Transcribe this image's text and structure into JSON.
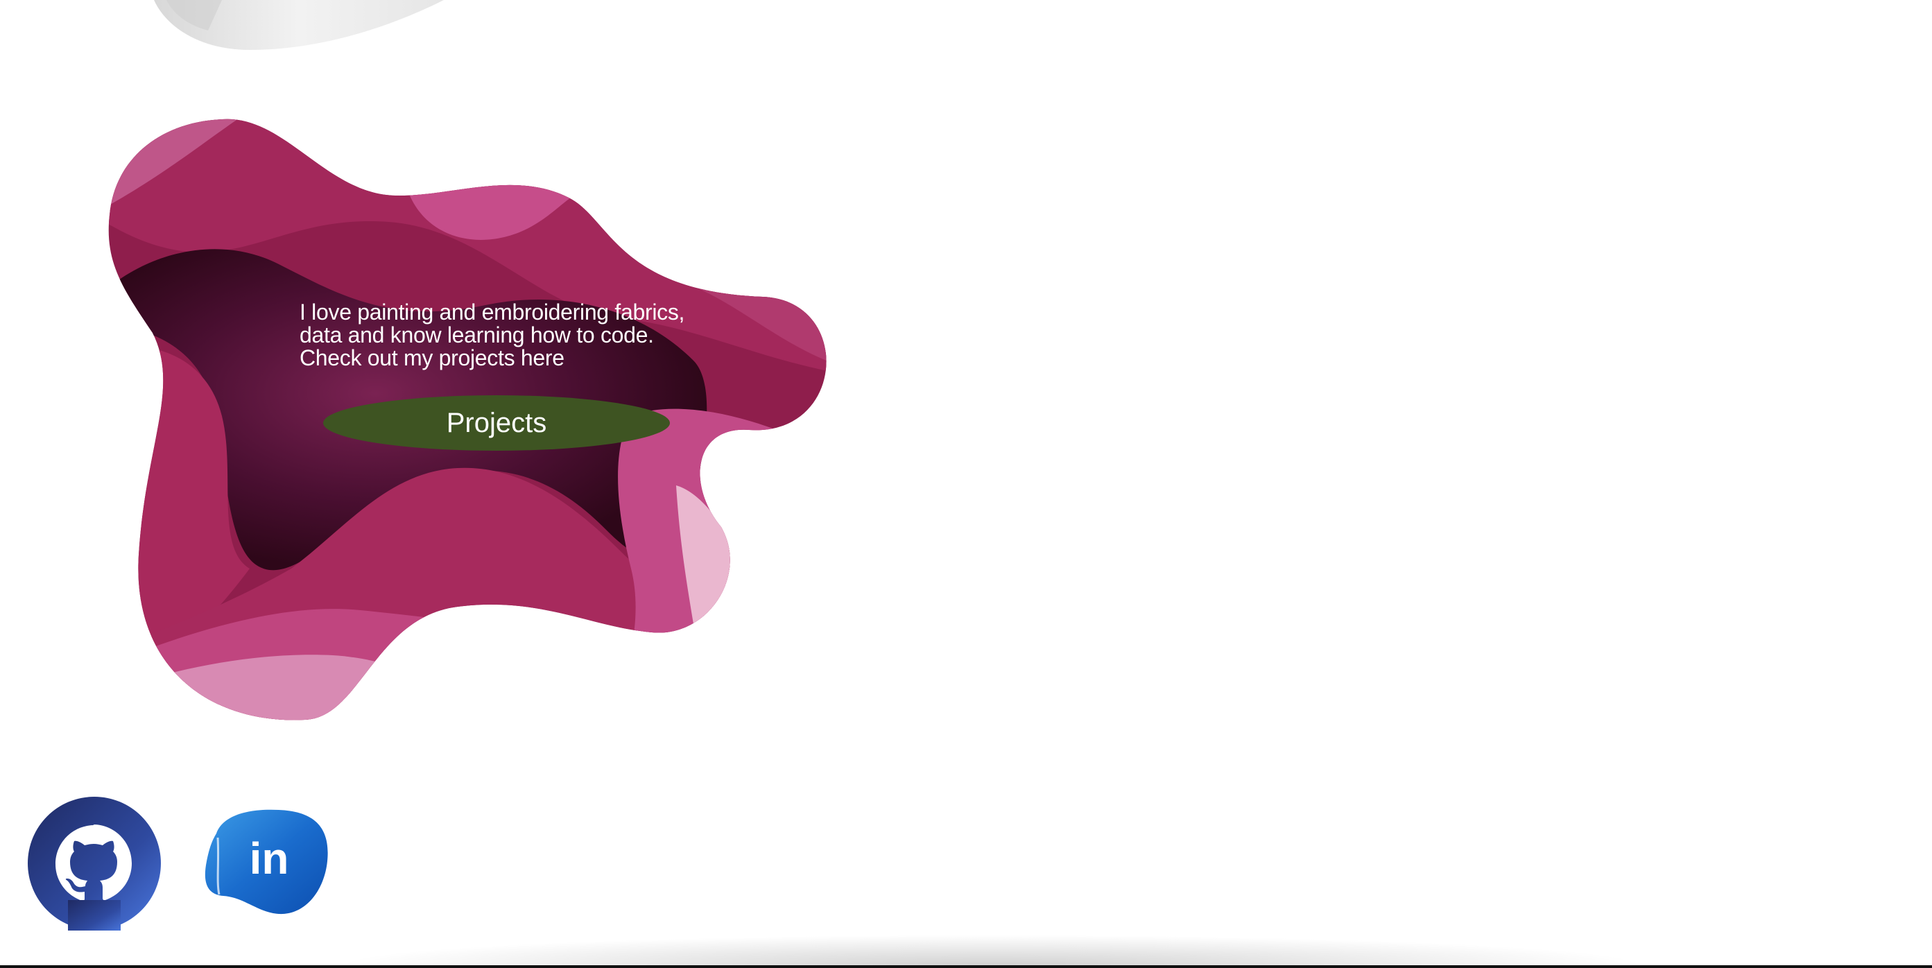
{
  "intro": {
    "lines": [
      "I love painting and embroidering fabrics,",
      "data and know learning how to code.",
      "Check out my projects here"
    ],
    "button_label": "Projects"
  },
  "social": {
    "github_icon": "github-octocat-icon",
    "linkedin_icon": "linkedin-icon",
    "linkedin_text": "in"
  },
  "colors": {
    "button": "#3e5422",
    "blob_base": "#9b2557",
    "blob_dark": "#3a0a25",
    "blob_light": "#d06aa0",
    "github_blue": "#2d4fa8",
    "linkedin_blue": "#1a6ccd"
  }
}
